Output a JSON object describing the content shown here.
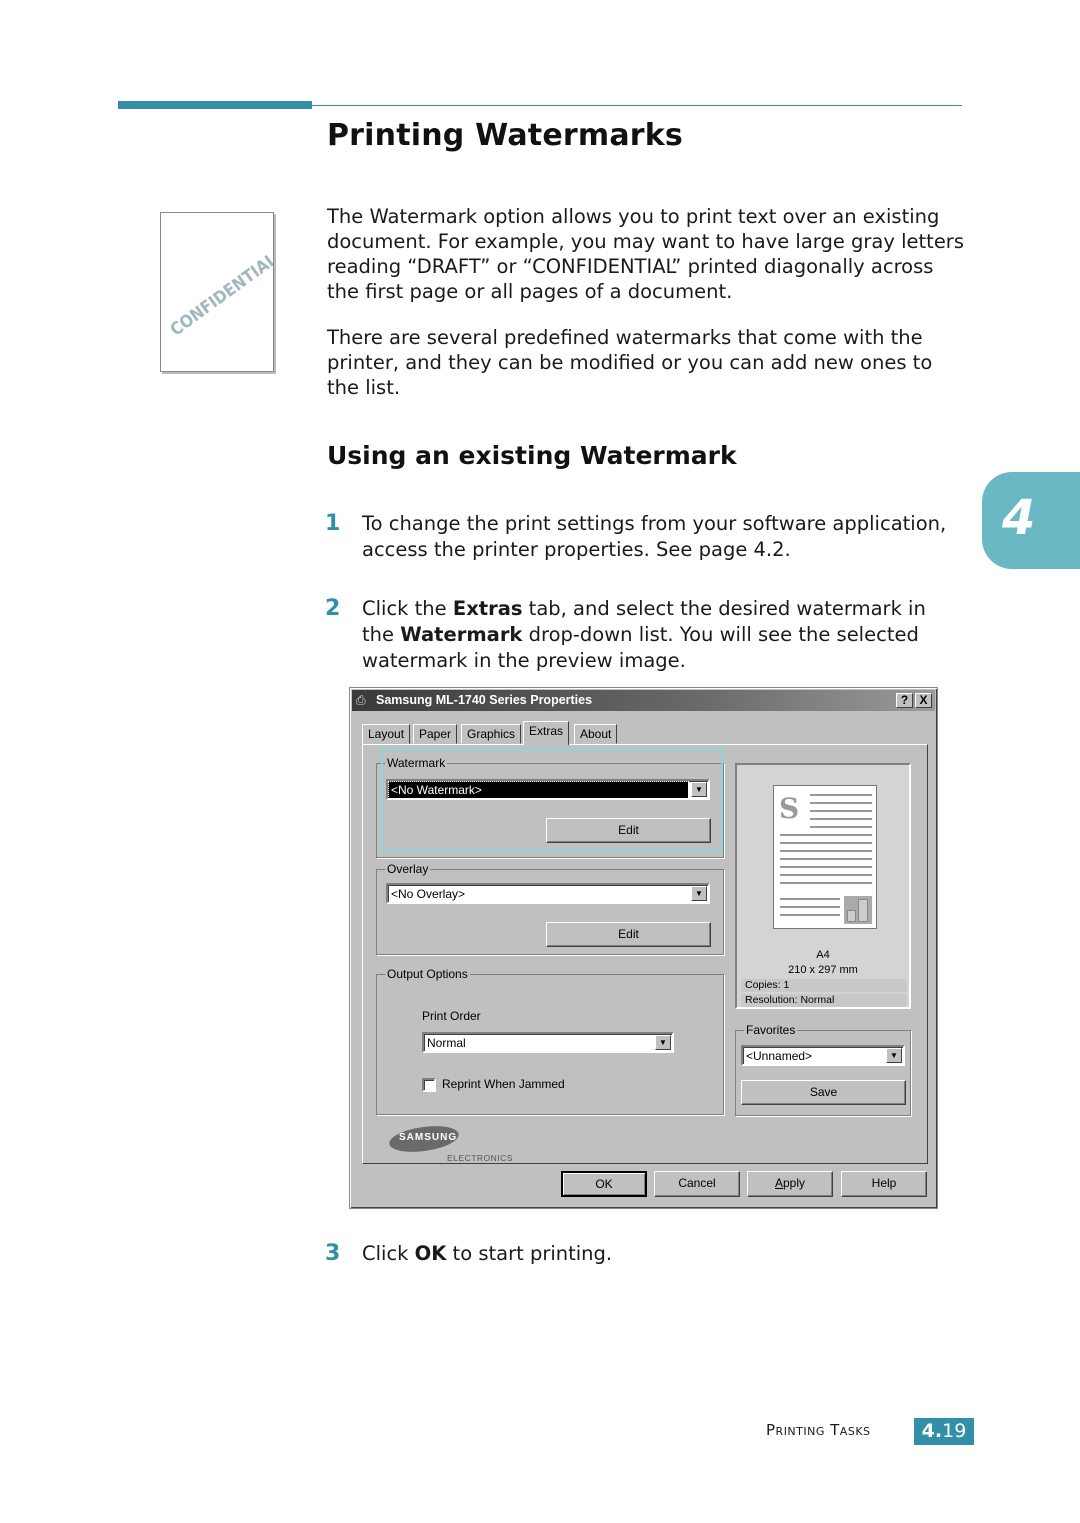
{
  "page": {
    "title": "Printing Watermarks",
    "intro_paragraphs": [
      "The Watermark option allows you to print text over an existing document. For example, you may want to have large gray letters reading “DRAFT” or “CONFIDENTIAL” printed diagonally across the first page or all pages of a document.",
      "There are several predefined watermarks that come with the printer, and they can be modified or you can add new ones to the list."
    ],
    "illustration_text": "CONFIDENTIAL",
    "subheading": "Using an existing Watermark",
    "steps": [
      {
        "num": "1",
        "parts": [
          {
            "t": "To change the print settings from your software application, access the printer properties. See page 4.2.",
            "b": false
          }
        ]
      },
      {
        "num": "2",
        "parts": [
          {
            "t": "Click the ",
            "b": false
          },
          {
            "t": "Extras",
            "b": true
          },
          {
            "t": " tab, and select the desired watermark in the ",
            "b": false
          },
          {
            "t": "Watermark",
            "b": true
          },
          {
            "t": " drop-down list. You will see the selected watermark in the preview image.",
            "b": false
          }
        ]
      },
      {
        "num": "3",
        "parts": [
          {
            "t": "Click ",
            "b": false
          },
          {
            "t": "OK",
            "b": true
          },
          {
            "t": " to start printing.",
            "b": false
          }
        ]
      }
    ],
    "chapter_number": "4",
    "footer": {
      "section": "Printing Tasks",
      "page_prefix": "4.",
      "page_number": "19"
    },
    "colors": {
      "accent": "#338fa8",
      "chapter_tab": "#6ab8c4",
      "highlight": "#8fd3dc"
    }
  },
  "dialog": {
    "title": "Samsung ML-1740 Series Properties",
    "help_button": "?",
    "close_button": "X",
    "tabs": [
      {
        "label": "Layout",
        "active": false
      },
      {
        "label": "Paper",
        "active": false
      },
      {
        "label": "Graphics",
        "active": false
      },
      {
        "label": "Extras",
        "active": true
      },
      {
        "label": "About",
        "active": false
      }
    ],
    "watermark": {
      "label": "Watermark",
      "value": "<No Watermark>",
      "edit": "Edit"
    },
    "overlay": {
      "label": "Overlay",
      "value": "<No Overlay>",
      "edit": "Edit"
    },
    "output_options": {
      "label": "Output Options",
      "print_order_label": "Print Order",
      "print_order_value": "Normal",
      "reprint_label": "Reprint When Jammed",
      "reprint_checked": false
    },
    "preview": {
      "paper_letter": "S",
      "size": "A4",
      "dimensions": "210 x 297 mm",
      "copies": "Copies: 1",
      "resolution": "Resolution: Normal"
    },
    "favorites": {
      "label": "Favorites",
      "value": "<Unnamed>",
      "save": "Save"
    },
    "logo": {
      "brand": "SAMSUNG",
      "sub": "ELECTRONICS"
    },
    "buttons": {
      "ok": "OK",
      "cancel": "Cancel",
      "apply": "Apply",
      "help": "Help"
    }
  }
}
